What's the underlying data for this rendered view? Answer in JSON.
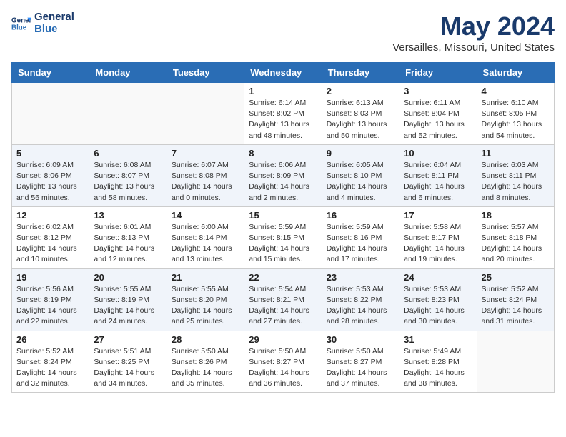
{
  "header": {
    "logo_line1": "General",
    "logo_line2": "Blue",
    "month_title": "May 2024",
    "location": "Versailles, Missouri, United States"
  },
  "days_of_week": [
    "Sunday",
    "Monday",
    "Tuesday",
    "Wednesday",
    "Thursday",
    "Friday",
    "Saturday"
  ],
  "weeks": [
    {
      "days": [
        {
          "num": "",
          "info": ""
        },
        {
          "num": "",
          "info": ""
        },
        {
          "num": "",
          "info": ""
        },
        {
          "num": "1",
          "info": "Sunrise: 6:14 AM\nSunset: 8:02 PM\nDaylight: 13 hours\nand 48 minutes."
        },
        {
          "num": "2",
          "info": "Sunrise: 6:13 AM\nSunset: 8:03 PM\nDaylight: 13 hours\nand 50 minutes."
        },
        {
          "num": "3",
          "info": "Sunrise: 6:11 AM\nSunset: 8:04 PM\nDaylight: 13 hours\nand 52 minutes."
        },
        {
          "num": "4",
          "info": "Sunrise: 6:10 AM\nSunset: 8:05 PM\nDaylight: 13 hours\nand 54 minutes."
        }
      ]
    },
    {
      "days": [
        {
          "num": "5",
          "info": "Sunrise: 6:09 AM\nSunset: 8:06 PM\nDaylight: 13 hours\nand 56 minutes."
        },
        {
          "num": "6",
          "info": "Sunrise: 6:08 AM\nSunset: 8:07 PM\nDaylight: 13 hours\nand 58 minutes."
        },
        {
          "num": "7",
          "info": "Sunrise: 6:07 AM\nSunset: 8:08 PM\nDaylight: 14 hours\nand 0 minutes."
        },
        {
          "num": "8",
          "info": "Sunrise: 6:06 AM\nSunset: 8:09 PM\nDaylight: 14 hours\nand 2 minutes."
        },
        {
          "num": "9",
          "info": "Sunrise: 6:05 AM\nSunset: 8:10 PM\nDaylight: 14 hours\nand 4 minutes."
        },
        {
          "num": "10",
          "info": "Sunrise: 6:04 AM\nSunset: 8:11 PM\nDaylight: 14 hours\nand 6 minutes."
        },
        {
          "num": "11",
          "info": "Sunrise: 6:03 AM\nSunset: 8:11 PM\nDaylight: 14 hours\nand 8 minutes."
        }
      ]
    },
    {
      "days": [
        {
          "num": "12",
          "info": "Sunrise: 6:02 AM\nSunset: 8:12 PM\nDaylight: 14 hours\nand 10 minutes."
        },
        {
          "num": "13",
          "info": "Sunrise: 6:01 AM\nSunset: 8:13 PM\nDaylight: 14 hours\nand 12 minutes."
        },
        {
          "num": "14",
          "info": "Sunrise: 6:00 AM\nSunset: 8:14 PM\nDaylight: 14 hours\nand 13 minutes."
        },
        {
          "num": "15",
          "info": "Sunrise: 5:59 AM\nSunset: 8:15 PM\nDaylight: 14 hours\nand 15 minutes."
        },
        {
          "num": "16",
          "info": "Sunrise: 5:59 AM\nSunset: 8:16 PM\nDaylight: 14 hours\nand 17 minutes."
        },
        {
          "num": "17",
          "info": "Sunrise: 5:58 AM\nSunset: 8:17 PM\nDaylight: 14 hours\nand 19 minutes."
        },
        {
          "num": "18",
          "info": "Sunrise: 5:57 AM\nSunset: 8:18 PM\nDaylight: 14 hours\nand 20 minutes."
        }
      ]
    },
    {
      "days": [
        {
          "num": "19",
          "info": "Sunrise: 5:56 AM\nSunset: 8:19 PM\nDaylight: 14 hours\nand 22 minutes."
        },
        {
          "num": "20",
          "info": "Sunrise: 5:55 AM\nSunset: 8:19 PM\nDaylight: 14 hours\nand 24 minutes."
        },
        {
          "num": "21",
          "info": "Sunrise: 5:55 AM\nSunset: 8:20 PM\nDaylight: 14 hours\nand 25 minutes."
        },
        {
          "num": "22",
          "info": "Sunrise: 5:54 AM\nSunset: 8:21 PM\nDaylight: 14 hours\nand 27 minutes."
        },
        {
          "num": "23",
          "info": "Sunrise: 5:53 AM\nSunset: 8:22 PM\nDaylight: 14 hours\nand 28 minutes."
        },
        {
          "num": "24",
          "info": "Sunrise: 5:53 AM\nSunset: 8:23 PM\nDaylight: 14 hours\nand 30 minutes."
        },
        {
          "num": "25",
          "info": "Sunrise: 5:52 AM\nSunset: 8:24 PM\nDaylight: 14 hours\nand 31 minutes."
        }
      ]
    },
    {
      "days": [
        {
          "num": "26",
          "info": "Sunrise: 5:52 AM\nSunset: 8:24 PM\nDaylight: 14 hours\nand 32 minutes."
        },
        {
          "num": "27",
          "info": "Sunrise: 5:51 AM\nSunset: 8:25 PM\nDaylight: 14 hours\nand 34 minutes."
        },
        {
          "num": "28",
          "info": "Sunrise: 5:50 AM\nSunset: 8:26 PM\nDaylight: 14 hours\nand 35 minutes."
        },
        {
          "num": "29",
          "info": "Sunrise: 5:50 AM\nSunset: 8:27 PM\nDaylight: 14 hours\nand 36 minutes."
        },
        {
          "num": "30",
          "info": "Sunrise: 5:50 AM\nSunset: 8:27 PM\nDaylight: 14 hours\nand 37 minutes."
        },
        {
          "num": "31",
          "info": "Sunrise: 5:49 AM\nSunset: 8:28 PM\nDaylight: 14 hours\nand 38 minutes."
        },
        {
          "num": "",
          "info": ""
        }
      ]
    }
  ]
}
